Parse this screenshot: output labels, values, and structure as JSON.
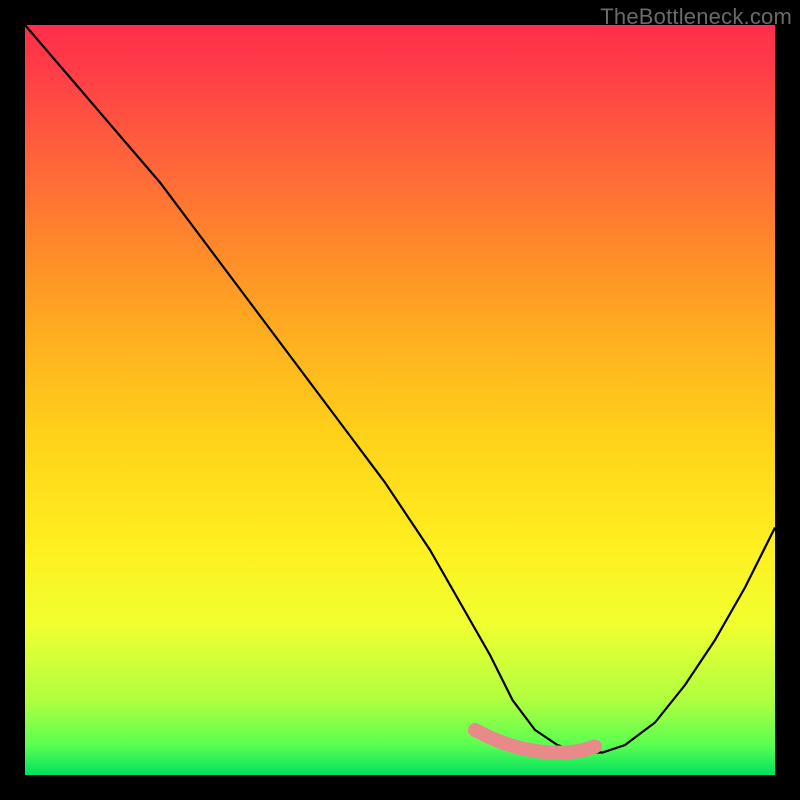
{
  "watermark": "TheBottleneck.com",
  "chart_data": {
    "type": "line",
    "title": "",
    "xlabel": "",
    "ylabel": "",
    "xlim": [
      0,
      100
    ],
    "ylim": [
      0,
      100
    ],
    "grid": false,
    "legend": false,
    "annotations": [],
    "series": [
      {
        "name": "curve",
        "style": "thin-black",
        "x": [
          0,
          6,
          12,
          18,
          24,
          30,
          36,
          42,
          48,
          54,
          58,
          62,
          65,
          68,
          71,
          74,
          77,
          80,
          84,
          88,
          92,
          96,
          100
        ],
        "values": [
          100,
          93,
          86,
          79,
          71,
          63,
          55,
          47,
          39,
          30,
          23,
          16,
          10,
          6,
          4,
          3,
          3,
          4,
          7,
          12,
          18,
          25,
          33
        ]
      },
      {
        "name": "pink-highlight",
        "style": "thick-pink",
        "x": [
          60,
          62,
          64,
          66,
          68,
          70,
          72,
          74,
          76
        ],
        "values": [
          6,
          5.0,
          4.2,
          3.6,
          3.2,
          3.0,
          3.0,
          3.2,
          3.8
        ]
      }
    ]
  }
}
